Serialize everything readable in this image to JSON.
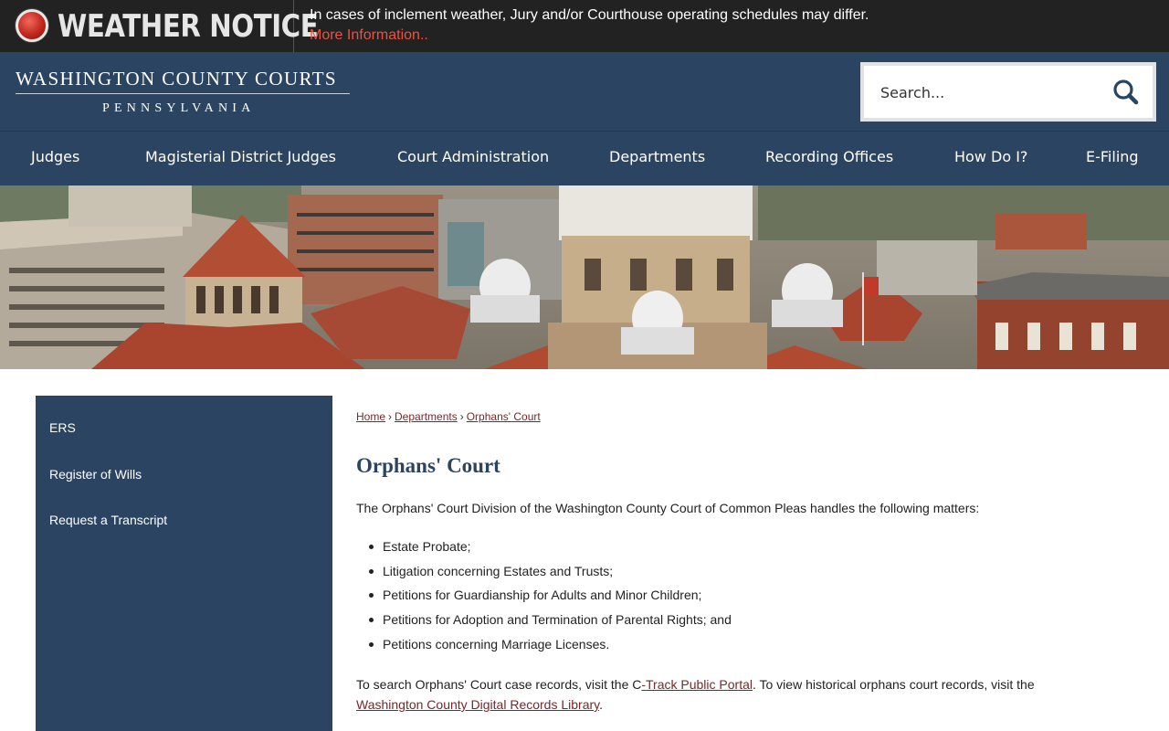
{
  "weather_notice": {
    "title": "WEATHER NOTICE",
    "message": "In cases of inclement weather, Jury and/or Courthouse operating schedules may differ.",
    "link": "More Information.."
  },
  "header": {
    "logo_main": "WASHINGTON COUNTY COURTS",
    "logo_sub": "PENNSYLVANIA",
    "search_placeholder": "Search..."
  },
  "nav": {
    "items": [
      {
        "label": "Judges"
      },
      {
        "label": "Magisterial District Judges"
      },
      {
        "label": "Court Administration"
      },
      {
        "label": "Departments"
      },
      {
        "label": "Recording Offices"
      },
      {
        "label": "How Do I?"
      },
      {
        "label": "E-Filing"
      }
    ]
  },
  "sidebar": {
    "items": [
      {
        "label": "ERS"
      },
      {
        "label": "Register of Wills"
      },
      {
        "label": "Request a Transcript"
      }
    ]
  },
  "breadcrumb": {
    "items": [
      {
        "label": "Home"
      },
      {
        "label": "Departments"
      },
      {
        "label": "Orphans' Court"
      }
    ],
    "separator": "›"
  },
  "main": {
    "title": "Orphans' Court",
    "intro": "The Orphans' Court Division of the Washington County Court of Common Pleas handles the following matters:",
    "matters": [
      "Estate Probate;",
      "Litigation concerning Estates and Trusts;",
      "Petitions for Guardianship for Adults and Minor Children;",
      "Petitions for Adoption and Termination of Parental Rights; and",
      "Petitions concerning Marriage Licenses."
    ],
    "records": {
      "text_1": "To search Orphans' Court case records, visit the C",
      "link_1": "-Track Public Portal",
      "text_2": ". To view historical orphans court records, visit the ",
      "link_2": "Washington County Digital Records Library",
      "text_3": "."
    }
  },
  "colors": {
    "navy": "#2b4461",
    "notice_bg": "#222222",
    "notice_link": "#e8553e",
    "link": "#7a2828"
  }
}
